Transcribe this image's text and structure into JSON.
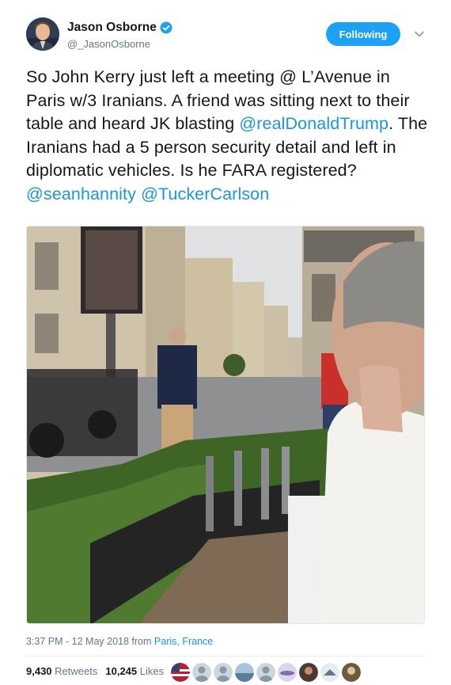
{
  "author": {
    "name": "Jason Osborne",
    "handle": "@_JasonOsborne",
    "verified": true
  },
  "follow_button": {
    "label": "Following"
  },
  "tweet": {
    "text_segments": [
      {
        "text": "So John Kerry just left a meeting @ L’Avenue in Paris w/3 Iranians. A friend was sitting next to their table and heard JK blasting ",
        "link": false
      },
      {
        "text": "@realDonaldTrump",
        "link": true
      },
      {
        "text": ". The Iranians had a 5 person security detail and left in diplomatic vehicles. Is he FARA registered? ",
        "link": false
      },
      {
        "text": "@seanhannity",
        "link": true
      },
      {
        "text": " ",
        "link": false
      },
      {
        "text": "@TuckerCarlson",
        "link": true
      }
    ]
  },
  "meta": {
    "timestamp": "3:37 PM - 12 May 2018",
    "from_label": "from",
    "location": "Paris, France"
  },
  "stats": {
    "retweets_count": "9,430",
    "retweets_label": "Retweets",
    "likes_count": "10,245",
    "likes_label": "Likes"
  },
  "colors": {
    "accent": "#1da1f2",
    "link": "#1b95e0",
    "muted": "#657786"
  }
}
